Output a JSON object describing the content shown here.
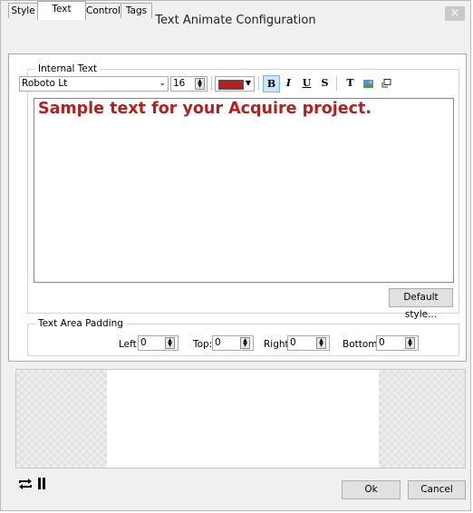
{
  "window": {
    "title": "Text Animate Configuration",
    "close_glyph": "×"
  },
  "tabs": [
    {
      "label": "Style",
      "active": false
    },
    {
      "label": "Text",
      "active": true
    },
    {
      "label": "Control",
      "active": false
    },
    {
      "label": "Tags",
      "active": false
    }
  ],
  "internal_text": {
    "group_label": "Internal Text",
    "font_family": "Roboto Lt",
    "font_size": "16",
    "text_color": "#b32020",
    "toolbar": {
      "bold_glyph": "B",
      "italic_glyph": "I",
      "underline_glyph": "U",
      "strike_glyph": "S",
      "font_glyph": "T",
      "bold_active": true
    },
    "content": "Sample text for your Acquire project.",
    "default_style_label": "Default style..."
  },
  "padding": {
    "group_label": "Text Area Padding",
    "left_label": "Left:",
    "left_value": "0",
    "top_label": "Top:",
    "top_value": "0",
    "right_label": "Right:",
    "right_value": "0",
    "bottom_label": "Bottom:",
    "bottom_value": "0"
  },
  "footer": {
    "ok_label": "Ok",
    "cancel_label": "Cancel",
    "loop_icon": "repeat-icon",
    "pause_icon": "pause-icon"
  }
}
